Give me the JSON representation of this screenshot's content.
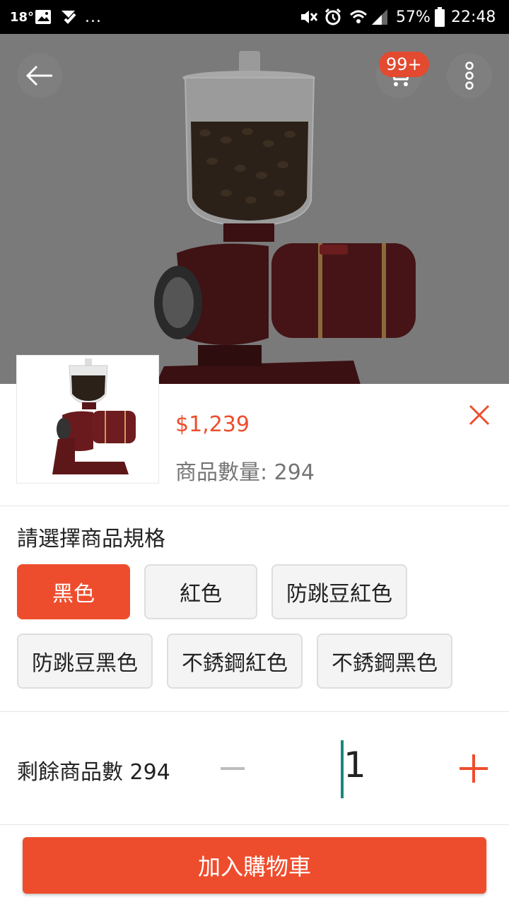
{
  "status_bar": {
    "temperature": "18°",
    "more": "...",
    "battery": "57%",
    "time": "22:48"
  },
  "header": {
    "cart_badge": "99+"
  },
  "product": {
    "price": "$1,239",
    "stock_text": "商品數量: 294"
  },
  "variants": {
    "title": "請選擇商品規格",
    "options": [
      "黑色",
      "紅色",
      "防跳豆紅色",
      "防跳豆黑色",
      "不銹鋼紅色",
      "不銹鋼黑色"
    ],
    "selected": "黑色"
  },
  "quantity": {
    "label": "剩餘商品數 294",
    "value": "1"
  },
  "actions": {
    "add_to_cart": "加入購物車"
  },
  "colors": {
    "accent": "#ee4d2d",
    "cursor": "#16897a"
  }
}
